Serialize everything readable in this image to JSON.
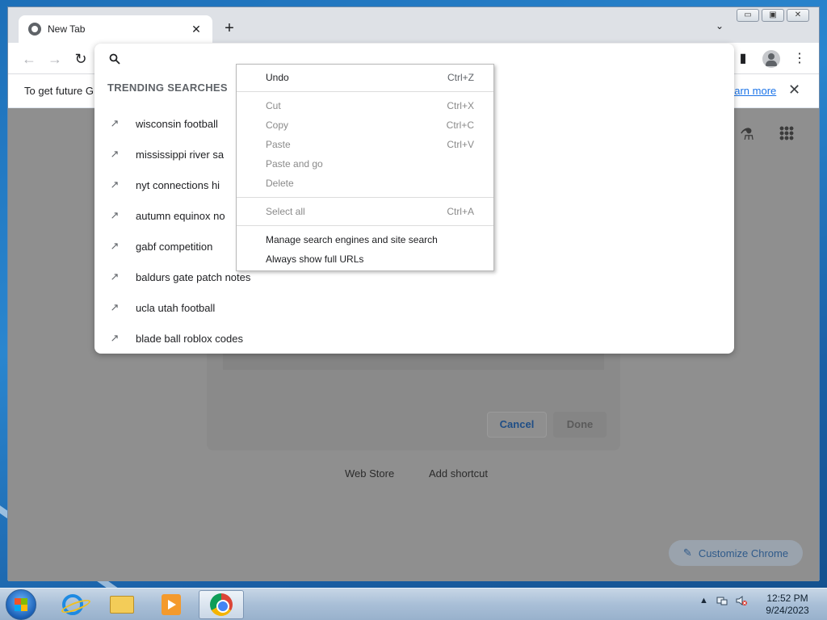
{
  "browser": {
    "tab": {
      "title": "New Tab",
      "close_glyph": "✕",
      "icon": "chrome-favicon-icon"
    },
    "new_tab_glyph": "+",
    "tab_search_glyph": "⌄",
    "window_controls": {
      "minimize": "▭",
      "maximize": "▣",
      "close": "✕"
    },
    "nav": {
      "back": "←",
      "forward": "→",
      "reload": "↻"
    },
    "toolbar_icons": {
      "side_panel": "▮",
      "profile": "profile-icon",
      "menu": "⋮"
    }
  },
  "infobar": {
    "text": "To get future G",
    "link": "earn more",
    "close": "✕"
  },
  "omnibox": {
    "search_icon": "🔍",
    "dropdown": {
      "header": "TRENDING SEARCHES",
      "trend_glyph": "↗",
      "items": [
        "wisconsin football",
        "mississippi river sa",
        "nyt connections hi",
        "autumn equinox no",
        "gabf competition",
        "baldurs gate patch notes",
        "ucla utah football",
        "blade ball roblox codes"
      ]
    }
  },
  "context_menu": {
    "groups": [
      [
        {
          "label": "Undo",
          "shortcut": "Ctrl+Z",
          "enabled": true
        }
      ],
      [
        {
          "label": "Cut",
          "shortcut": "Ctrl+X",
          "enabled": false
        },
        {
          "label": "Copy",
          "shortcut": "Ctrl+C",
          "enabled": false
        },
        {
          "label": "Paste",
          "shortcut": "Ctrl+V",
          "enabled": false
        },
        {
          "label": "Paste and go",
          "shortcut": "",
          "enabled": false
        },
        {
          "label": "Delete",
          "shortcut": "",
          "enabled": false
        }
      ],
      [
        {
          "label": "Select all",
          "shortcut": "Ctrl+A",
          "enabled": false
        }
      ],
      [
        {
          "label": "Manage search engines and site search",
          "shortcut": "",
          "enabled": true
        },
        {
          "label": "Always show full URLs",
          "shortcut": "",
          "enabled": true
        }
      ]
    ]
  },
  "dialog": {
    "cancel": "Cancel",
    "done": "Done"
  },
  "ntp": {
    "shortcuts": [
      "Web Store",
      "Add shortcut"
    ],
    "customize": "Customize Chrome",
    "customize_glyph": "✎",
    "labs_glyph": "⚗"
  },
  "taskbar": {
    "apps": [
      "start-orb",
      "internet-explorer-icon",
      "file-explorer-icon",
      "media-player-icon",
      "chrome-icon"
    ],
    "tray": {
      "arrow": "▲",
      "network": "network-icon",
      "volume": "volume-muted-icon"
    },
    "clock": {
      "time": "12:52 PM",
      "date": "9/24/2023"
    }
  },
  "colors": {
    "accent": "#1a73e8",
    "dim_overlay": "#8f8f8f",
    "taskbar": "#a9bfd7"
  }
}
